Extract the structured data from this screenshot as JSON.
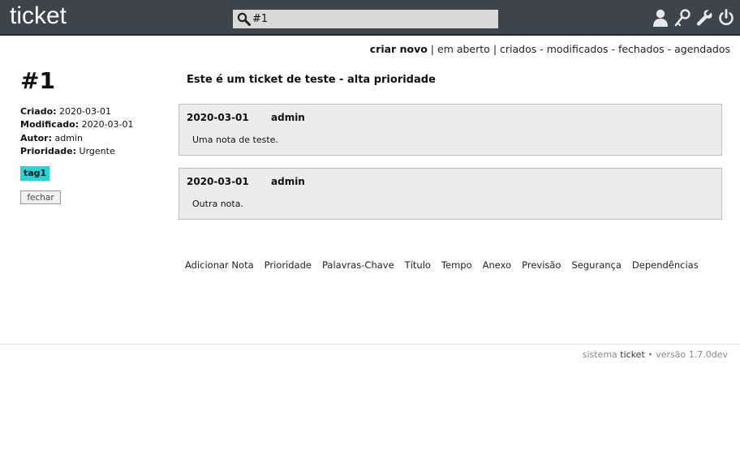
{
  "header": {
    "logo": "ticket",
    "search": {
      "value": "#1",
      "icon": "search-icon"
    },
    "icons": [
      "user-icon",
      "key-icon",
      "wrench-icon",
      "power-icon"
    ]
  },
  "nav": {
    "create_new": "criar novo",
    "sep1": "|",
    "open": "em aberto",
    "sep2": "|",
    "created": "criados",
    "sep3": "-",
    "modified": "modificados",
    "sep4": "-",
    "closed": "fechados",
    "sep5": "-",
    "scheduled": "agendados"
  },
  "ticket": {
    "id": "#1",
    "title": "Este é um ticket de teste - alta prioridade",
    "meta": {
      "created_label": "Criado:",
      "created": "2020-03-01",
      "modified_label": "Modificado:",
      "modified": "2020-03-01",
      "author_label": "Autor:",
      "author": "admin",
      "priority_label": "Prioridade:",
      "priority": "Urgente"
    },
    "tags": [
      "tag1"
    ],
    "close_label": "fechar"
  },
  "notes": [
    {
      "date": "2020-03-01",
      "author": "admin",
      "text": "Uma nota de teste."
    },
    {
      "date": "2020-03-01",
      "author": "admin",
      "text": "Outra nota."
    }
  ],
  "actions": [
    "Adicionar Nota",
    "Prioridade",
    "Palavras-Chave",
    "Título",
    "Tempo",
    "Anexo",
    "Previsão",
    "Segurança",
    "Dependências"
  ],
  "footer": {
    "prefix": "sistema",
    "brand": "ticket",
    "suffix": "• versão 1.7.0dev"
  },
  "colors": {
    "header_bg": "#3e444c",
    "tag_bg": "#1fd6d8",
    "note_bg": "#ececec"
  }
}
